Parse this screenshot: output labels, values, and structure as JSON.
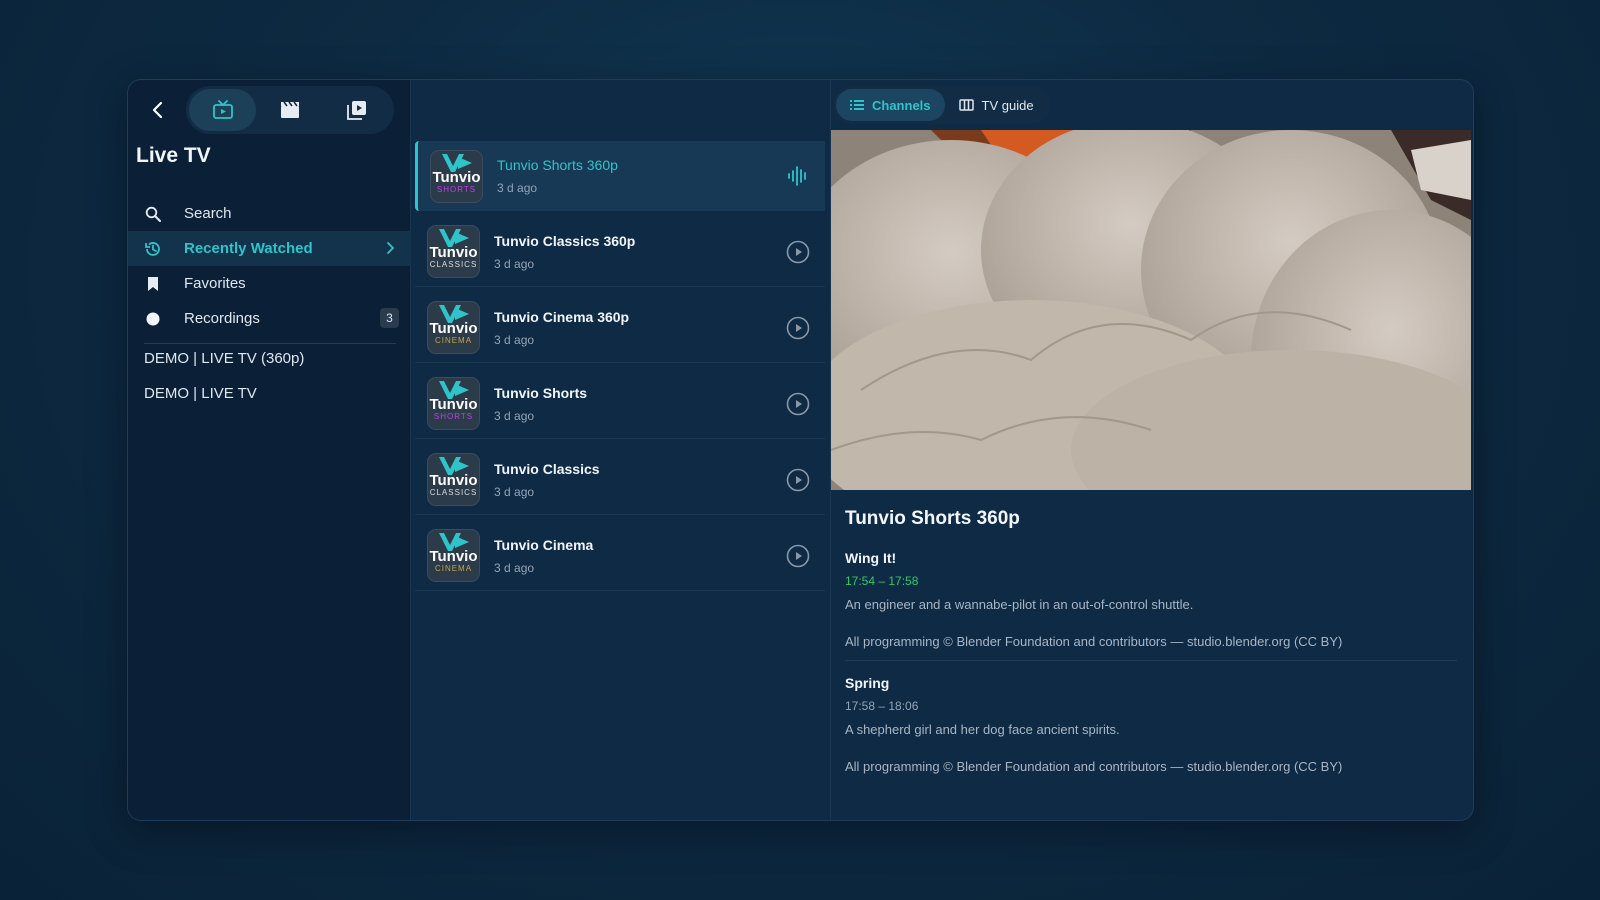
{
  "sidebar": {
    "title": "Live TV",
    "nav": [
      {
        "label": "Search"
      },
      {
        "label": "Recently Watched"
      },
      {
        "label": "Favorites"
      },
      {
        "label": "Recordings",
        "badge": "3"
      }
    ],
    "groups": [
      "DEMO | LIVE TV (360p)",
      "DEMO | LIVE TV"
    ]
  },
  "tabs": {
    "channels": "Channels",
    "guide": "TV guide"
  },
  "channels": [
    {
      "name": "Tunvio Shorts 360p",
      "sub": "3 d ago",
      "logo_word": "Tunvio",
      "logo_sub": "SHORTS",
      "logo_color": "#c040e8",
      "playing": true
    },
    {
      "name": "Tunvio Classics 360p",
      "sub": "3 d ago",
      "logo_word": "Tunvio",
      "logo_sub": "CLASSICS",
      "logo_color": "#d8dde2"
    },
    {
      "name": "Tunvio Cinema 360p",
      "sub": "3 d ago",
      "logo_word": "Tunvio",
      "logo_sub": "CINEMA",
      "logo_color": "#c9a545"
    },
    {
      "name": "Tunvio Shorts",
      "sub": "3 d ago",
      "logo_word": "Tunvio",
      "logo_sub": "SHORTS",
      "logo_color": "#c040e8"
    },
    {
      "name": "Tunvio Classics",
      "sub": "3 d ago",
      "logo_word": "Tunvio",
      "logo_sub": "CLASSICS",
      "logo_color": "#d8dde2"
    },
    {
      "name": "Tunvio Cinema",
      "sub": "3 d ago",
      "logo_word": "Tunvio",
      "logo_sub": "CINEMA",
      "logo_color": "#c9a545"
    }
  ],
  "detail": {
    "channel_title": "Tunvio Shorts 360p",
    "programs": [
      {
        "title": "Wing It!",
        "time": "17:54 – 17:58",
        "desc": "An engineer and a wannabe-pilot in an out-of-control shuttle.",
        "credit": "All programming © Blender Foundation and contributors — studio.blender.org (CC BY)"
      },
      {
        "title": "Spring",
        "time": "17:58 – 18:06",
        "desc": "A shepherd girl and her dog face ancient spirits.",
        "credit": "All programming © Blender Foundation and contributors — studio.blender.org (CC BY)"
      }
    ]
  },
  "colors": {
    "accent": "#2fc4c9",
    "now_time": "#32c76a"
  }
}
